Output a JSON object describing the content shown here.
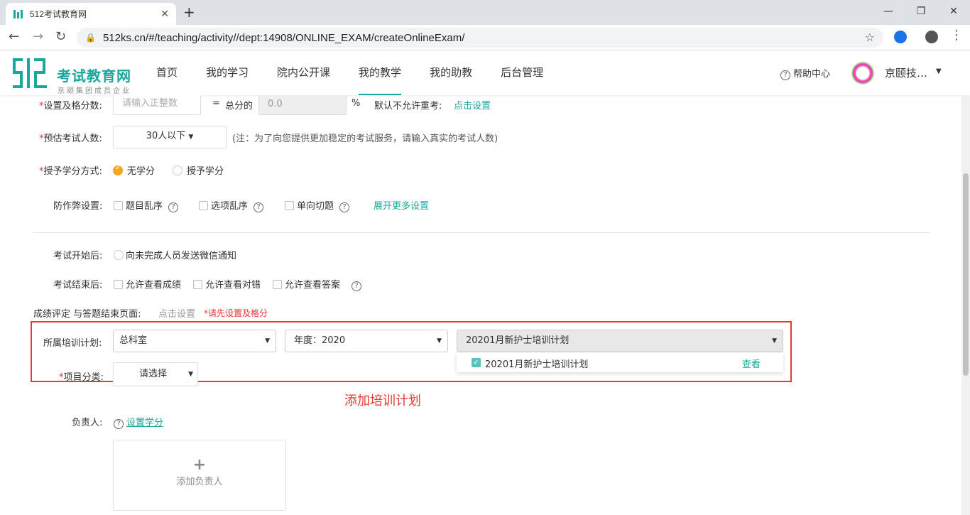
{
  "browser": {
    "tab_title": "512考试教育网",
    "url": "512ks.cn/#/teaching/activity//dept:14908/ONLINE_EXAM/createOnlineExam/",
    "new_tab": "+",
    "close_tab": "✕",
    "win_minimize": "—",
    "win_restore": "❐",
    "win_close": "✕"
  },
  "site": {
    "brand": "考试教育网",
    "brand_sub": "京颐集团成员企业",
    "nav": [
      "首页",
      "我的学习",
      "院内公开课",
      "我的教学",
      "我的助教",
      "后台管理"
    ],
    "help": "帮助中心",
    "username": "京颐技…"
  },
  "form": {
    "pass_label": "设置及格分数:",
    "pass_placeholder": "请输入正整数",
    "total_label": "总分的",
    "total_value": "0.0",
    "percent": "%",
    "retake_label": "默认不允许重考:",
    "retake_link": "点击设置",
    "estimate_label": "预估考试人数:",
    "estimate_value": "30人以下",
    "estimate_note": "(注：为了向您提供更加稳定的考试服务，请输入真实的考试人数)",
    "credit_label": "授予学分方式:",
    "credit_options": [
      "无学分",
      "授予学分"
    ],
    "anticheat_label": "防作弊设置:",
    "anticheat_options": [
      "题目乱序",
      "选项乱序",
      "单向切题"
    ],
    "anticheat_more": "展开更多设置",
    "after_start_label": "考试开始后:",
    "after_start_option": "向未完成人员发送微信通知",
    "after_end_label": "考试结束后:",
    "after_end_options": [
      "允许查看成绩",
      "允许查看对错",
      "允许查看答案"
    ],
    "grading_label": "成绩评定 与答题结束页面:",
    "grading_link": "点击设置",
    "grading_warn": "*请先设置及格分",
    "plan_label": "所属培训计划:",
    "plan_dept": "总科室",
    "plan_year": "年度：2020",
    "plan_name": "20201月新护士培训计划",
    "plan_option": "20201月新护士培训计划",
    "plan_view": "查看",
    "category_label": "项目分类:",
    "category_value": "请选择",
    "annotation": "添加培训计划",
    "owner_label": "负责人:",
    "owner_link": "设置学分",
    "add_owner": "添加负责人",
    "required_mark": "*"
  }
}
